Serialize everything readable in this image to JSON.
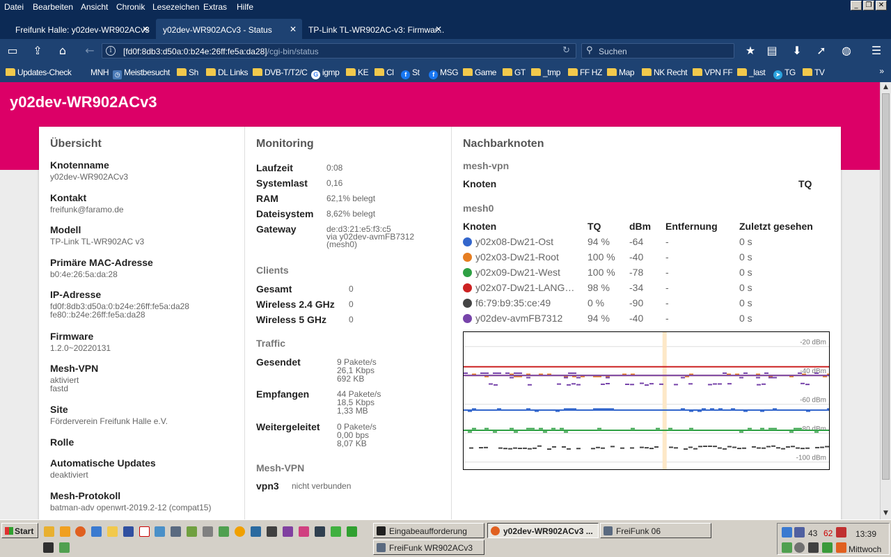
{
  "menubar": [
    "Datei",
    "Bearbeiten",
    "Ansicht",
    "Chronik",
    "Lesezeichen",
    "Extras",
    "Hilfe"
  ],
  "tabs": [
    {
      "label": "Freifunk Halle: y02dev-WR902ACv3"
    },
    {
      "label": "y02dev-WR902ACv3 - Status"
    },
    {
      "label": "TP-Link TL-WR902AC-v3: Firmwar..."
    }
  ],
  "nav": {
    "url_host": "[fd0f:8db3:d50a:0:b24e:26ff:fe5a:da28]",
    "url_path": "/cgi-bin/status",
    "search_placeholder": "Suchen"
  },
  "bookmarks": [
    "Updates-Check",
    "MNH",
    "Meistbesucht",
    "Sh",
    "DL Links",
    "DVB-T/T2/C",
    "igmp",
    "KE",
    "Cl",
    "St",
    "MSG",
    "Game",
    "GT",
    "_tmp",
    "FF HZ",
    "Map",
    "NK Recht",
    "VPN FF",
    "_last",
    "TG",
    "TV"
  ],
  "page": {
    "title": "y02dev-WR902ACv3",
    "overview": {
      "heading": "Übersicht",
      "fields": [
        {
          "label": "Knotenname",
          "lines": [
            "y02dev-WR902ACv3"
          ]
        },
        {
          "label": "Kontakt",
          "lines": [
            "freifunk@faramo.de"
          ]
        },
        {
          "label": "Modell",
          "lines": [
            "TP-Link TL-WR902AC v3"
          ]
        },
        {
          "label": "Primäre MAC-Adresse",
          "lines": [
            "b0:4e:26:5a:da:28"
          ]
        },
        {
          "label": "IP-Adresse",
          "lines": [
            "fd0f:8db3:d50a:0:b24e:26ff:fe5a:da28",
            "fe80::b24e:26ff:fe5a:da28"
          ]
        },
        {
          "label": "Firmware",
          "lines": [
            "1.2.0~20220131"
          ]
        },
        {
          "label": "Mesh-VPN",
          "lines": [
            "aktiviert",
            "fastd"
          ]
        },
        {
          "label": "Site",
          "lines": [
            "Förderverein Freifunk Halle e.V."
          ]
        },
        {
          "label": "Rolle",
          "lines": []
        },
        {
          "label": "Automatische Updates",
          "lines": [
            "deaktiviert"
          ]
        },
        {
          "label": "Mesh-Protokoll",
          "lines": [
            "batman-adv openwrt-2019.2-12 (compat15)"
          ]
        }
      ]
    },
    "monitoring": {
      "heading": "Monitoring",
      "rows": [
        {
          "label": "Laufzeit",
          "lines": [
            "0:08"
          ]
        },
        {
          "label": "Systemlast",
          "lines": [
            "0,16"
          ]
        },
        {
          "label": "RAM",
          "lines": [
            "62,1% belegt"
          ]
        },
        {
          "label": "Dateisystem",
          "lines": [
            "8,62% belegt"
          ]
        },
        {
          "label": "Gateway",
          "lines": [
            "de:d3:21:e5:f3:c5",
            "via y02dev-avmFB7312",
            "(mesh0)"
          ]
        }
      ],
      "clients_heading": "Clients",
      "clients": [
        {
          "label": "Gesamt",
          "value": "0"
        },
        {
          "label": "Wireless 2.4 GHz",
          "value": "0"
        },
        {
          "label": "Wireless 5 GHz",
          "value": "0"
        }
      ],
      "traffic_heading": "Traffic",
      "traffic": [
        {
          "label": "Gesendet",
          "lines": [
            "9 Pakete/s",
            "26,1 Kbps",
            "692 KB"
          ]
        },
        {
          "label": "Empfangen",
          "lines": [
            "44 Pakete/s",
            "18,5 Kbps",
            "1,33 MB"
          ]
        },
        {
          "label": "Weitergeleitet",
          "lines": [
            "0 Pakete/s",
            "0,00 bps",
            "8,07 KB"
          ]
        }
      ],
      "meshvpn_heading": "Mesh-VPN",
      "meshvpn": [
        {
          "label": "vpn3",
          "value": "nicht verbunden"
        }
      ]
    },
    "neighbours": {
      "heading": "Nachbarknoten",
      "vpn_heading": "mesh-vpn",
      "vpn_cols": [
        "Knoten",
        "TQ"
      ],
      "mesh0_heading": "mesh0",
      "mesh0_cols": [
        "Knoten",
        "TQ",
        "dBm",
        "Entfernung",
        "Zuletzt gesehen"
      ],
      "rows": [
        {
          "name": "y02x08-Dw21-Ost",
          "tq": "94 %",
          "dbm": "-64",
          "dist": "-",
          "seen": "0 s",
          "color": "#3366cc",
          "link": true
        },
        {
          "name": "y02x03-Dw21-Root",
          "tq": "100 %",
          "dbm": "-40",
          "dist": "-",
          "seen": "0 s",
          "color": "#e67e22",
          "link": true
        },
        {
          "name": "y02x09-Dw21-West",
          "tq": "100 %",
          "dbm": "-78",
          "dist": "-",
          "seen": "0 s",
          "color": "#2ea043",
          "link": true
        },
        {
          "name": "y02x07-Dw21-LANG…",
          "tq": "98 %",
          "dbm": "-34",
          "dist": "-",
          "seen": "0 s",
          "color": "#cc2222",
          "link": true
        },
        {
          "name": "f6:79:b9:35:ce:49",
          "tq": "0 %",
          "dbm": "-90",
          "dist": "-",
          "seen": "0 s",
          "color": "#444444",
          "link": false
        },
        {
          "name": "y02dev-avmFB7312",
          "tq": "94 %",
          "dbm": "-40",
          "dist": "-",
          "seen": "0 s",
          "color": "#7744aa",
          "link": true
        }
      ]
    }
  },
  "chart_data": {
    "type": "line",
    "ylim": [
      -105,
      -10
    ],
    "yticks": [
      {
        "value": -20,
        "label": "-20 dBm"
      },
      {
        "value": -40,
        "label": "-40 dBm"
      },
      {
        "value": -60,
        "label": "-60 dBm"
      },
      {
        "value": -80,
        "label": "-80 dBm"
      },
      {
        "value": -100,
        "label": "-100 dBm"
      }
    ],
    "marker_fraction": 0.55,
    "series": [
      {
        "color": "#cc2222",
        "level": -34,
        "jitter": 0,
        "gaps": 0
      },
      {
        "color": "#e67e22",
        "level": -40,
        "jitter": 1,
        "gaps": 0
      },
      {
        "color": "#7744aa",
        "level": -40,
        "jitter": 2,
        "gaps": 0
      },
      {
        "color": "#7744aa",
        "level": -46,
        "jitter": 1,
        "gaps": 0.55
      },
      {
        "color": "#3366cc",
        "level": -64,
        "jitter": 1,
        "gaps": 0
      },
      {
        "color": "#2ea043",
        "level": -78,
        "jitter": 1.5,
        "gaps": 0
      },
      {
        "color": "#444444",
        "level": -90,
        "jitter": 1.5,
        "gaps": 0.15
      }
    ]
  },
  "taskbar": {
    "start": "Start",
    "tasks": [
      "Eingabeaufforderung",
      "y02dev-WR902ACv3 ...",
      "FreiFunk 06",
      "FreiFunk WR902ACv3"
    ],
    "tray_a": "43",
    "tray_b": "62",
    "clock": "13:39",
    "day": "Mittwoch"
  }
}
